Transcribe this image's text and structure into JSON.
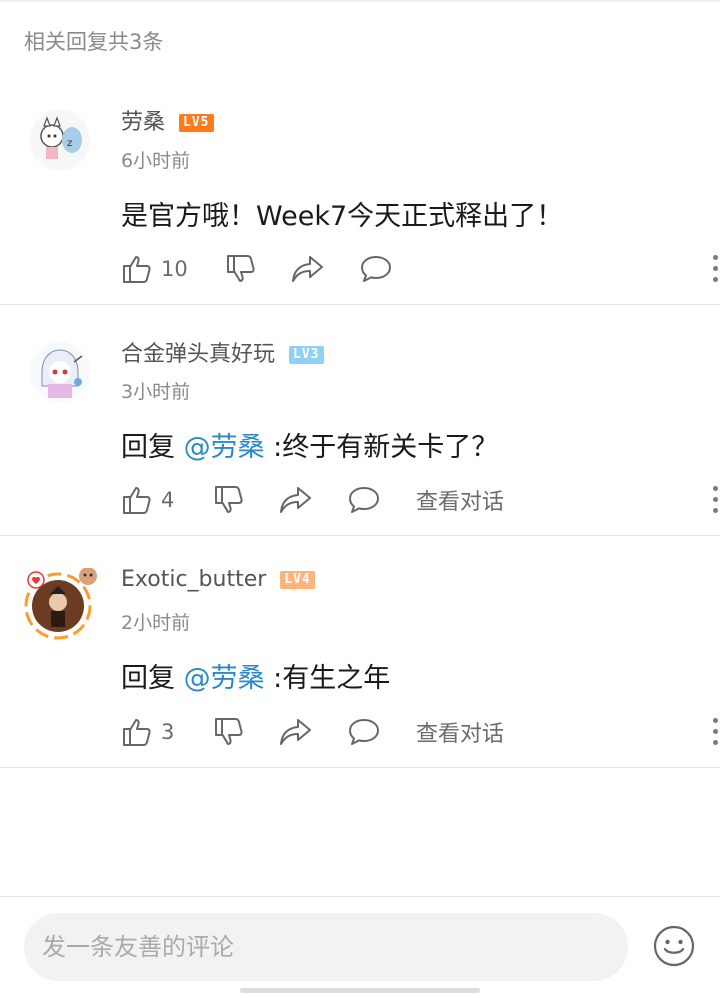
{
  "header": {
    "reply_count_label": "相关回复共3条"
  },
  "comments": [
    {
      "username": "劳桑",
      "level": "LV5",
      "level_color": "#ff7a1a",
      "time": "6小时前",
      "content": "是官方哦！Week7今天正式释出了！",
      "likes": "10",
      "view_conversation": ""
    },
    {
      "username": "合金弹头真好玩",
      "level": "LV3",
      "level_color": "#8fd1f3",
      "time": "3小时前",
      "reply_prefix": "回复 ",
      "mention": "@劳桑",
      "content": " :终于有新关卡了？",
      "likes": "4",
      "view_conversation": "查看对话"
    },
    {
      "username": "Exotic_butter",
      "level": "LV4",
      "level_color": "#ffb27a",
      "time": "2小时前",
      "reply_prefix": "回复 ",
      "mention": "@劳桑",
      "content": " :有生之年",
      "likes": "3",
      "view_conversation": "查看对话"
    }
  ],
  "icons": {
    "like": "thumbs-up-icon",
    "dislike": "thumbs-down-icon",
    "share": "share-icon",
    "reply": "comment-bubble-icon",
    "more": "more-vertical-icon",
    "emoji": "emoji-smile-icon"
  },
  "composer": {
    "placeholder": "发一条友善的评论"
  },
  "colors": {
    "mention": "#2a8ac7",
    "accent_orange": "#ff9a2e"
  }
}
